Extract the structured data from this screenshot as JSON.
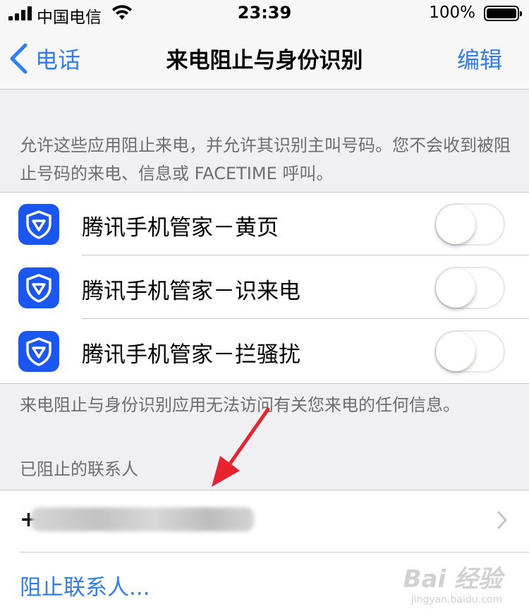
{
  "status_bar": {
    "carrier": "中国电信",
    "time": "23:39",
    "battery": "100%"
  },
  "nav": {
    "back_label": "电话",
    "title": "来电阻止与身份识别",
    "edit_label": "编辑"
  },
  "intro_note": "允许这些应用阻止来电，并允许其识别主叫号码。您不会收到被阻止号码的来电、信息或 FACETIME 呼叫。",
  "apps": [
    {
      "label": "腾讯手机管家－黄页",
      "enabled": false,
      "icon": "tencent-shield-icon"
    },
    {
      "label": "腾讯手机管家－识来电",
      "enabled": false,
      "icon": "tencent-shield-icon"
    },
    {
      "label": "腾讯手机管家－拦骚扰",
      "enabled": false,
      "icon": "tencent-shield-icon"
    }
  ],
  "apps_note": "来电阻止与身份识别应用无法访问有关您来电的任何信息。",
  "blocked_header": "已阻止的联系人",
  "blocked_contacts": [
    {
      "number_prefix": "+"
    }
  ],
  "block_contact_label": "阻止联系人...",
  "watermark": {
    "main": "Bai 经验",
    "sub": "jingyan.baidu.com"
  },
  "colors": {
    "accent": "#2f7cf6",
    "app_icon": "#1a56f0",
    "annotation_arrow": "#e8232d",
    "background": "#efeff4"
  }
}
